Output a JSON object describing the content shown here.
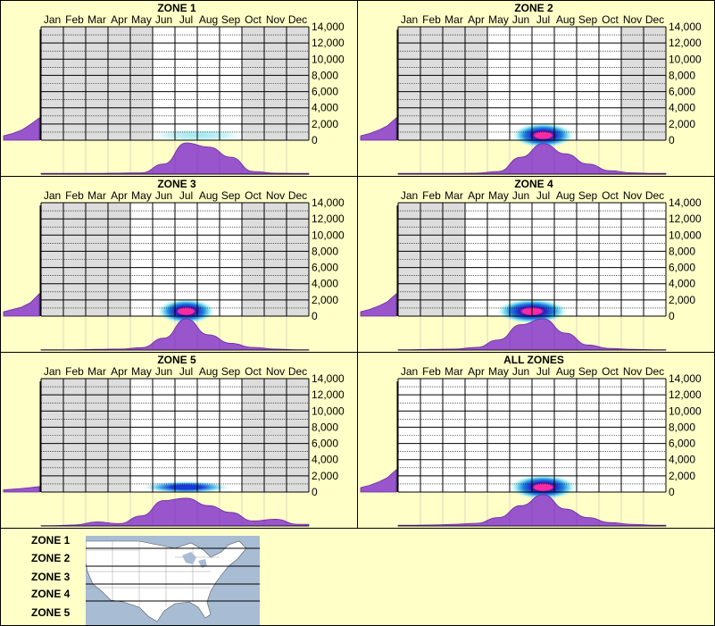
{
  "months": [
    "Jan",
    "Feb",
    "Mar",
    "Apr",
    "May",
    "Jun",
    "Jul",
    "Aug",
    "Sep",
    "Oct",
    "Nov",
    "Dec"
  ],
  "y_ticks": [
    "14,000",
    "12,000",
    "10,000",
    "8,000",
    "6,000",
    "4,000",
    "2,000",
    "0"
  ],
  "colors": {
    "background": "#ffffc8",
    "active_month": "#ffffff",
    "inactive_month": "#dddddd",
    "profile_fill": "#9955cc",
    "heat_core": "#ff2aa0",
    "heat_mid": "#1a2ad0",
    "heat_edge": "#bff0f5"
  },
  "chart_data": [
    {
      "type": "heatmap",
      "title": "ZONE 1",
      "ylim": [
        0,
        14000
      ],
      "active_months": [
        6,
        7,
        8,
        9
      ],
      "month_profile": [
        0.02,
        0.02,
        0.02,
        0.03,
        0.04,
        0.3,
        0.92,
        0.8,
        0.5,
        0.08,
        0.03,
        0.02
      ],
      "elevation_profile": [
        0.2,
        0.3,
        0.45,
        0.7,
        1.0
      ],
      "heat": {
        "month_center": 7.5,
        "month_spread": 2.2,
        "max_intensity": 0.3
      }
    },
    {
      "type": "heatmap",
      "title": "ZONE 2",
      "ylim": [
        0,
        14000
      ],
      "active_months": [
        5,
        6,
        7,
        8,
        9,
        10
      ],
      "month_profile": [
        0.02,
        0.02,
        0.02,
        0.03,
        0.08,
        0.5,
        0.9,
        0.6,
        0.3,
        0.1,
        0.04,
        0.02
      ],
      "elevation_profile": [
        0.2,
        0.3,
        0.45,
        0.65,
        1.0
      ],
      "heat": {
        "month_center": 7.0,
        "month_spread": 1.4,
        "max_intensity": 1.0
      }
    },
    {
      "type": "heatmap",
      "title": "ZONE 3",
      "ylim": [
        0,
        14000
      ],
      "active_months": [
        5,
        6,
        7,
        8,
        9
      ],
      "month_profile": [
        0.01,
        0.01,
        0.02,
        0.03,
        0.07,
        0.35,
        0.92,
        0.45,
        0.2,
        0.08,
        0.03,
        0.01
      ],
      "elevation_profile": [
        0.2,
        0.3,
        0.4,
        0.6,
        1.0
      ],
      "heat": {
        "month_center": 7.0,
        "month_spread": 1.3,
        "max_intensity": 1.0
      }
    },
    {
      "type": "heatmap",
      "title": "ZONE 4",
      "ylim": [
        0,
        14000
      ],
      "active_months": [
        4,
        5,
        6,
        7,
        8,
        9,
        10,
        11,
        12
      ],
      "month_profile": [
        0.01,
        0.02,
        0.03,
        0.08,
        0.3,
        0.75,
        0.92,
        0.5,
        0.15,
        0.05,
        0.02,
        0.01
      ],
      "elevation_profile": [
        0.2,
        0.3,
        0.45,
        0.65,
        1.0
      ],
      "heat": {
        "month_center": 6.5,
        "month_spread": 1.6,
        "max_intensity": 1.0
      }
    },
    {
      "type": "heatmap",
      "title": "ZONE 5",
      "ylim": [
        0,
        14000
      ],
      "active_months": [
        5,
        6,
        7,
        8,
        9
      ],
      "month_profile": [
        0.01,
        0.03,
        0.12,
        0.07,
        0.3,
        0.75,
        0.82,
        0.6,
        0.4,
        0.15,
        0.2,
        0.05
      ],
      "elevation_profile": [
        0.1,
        0.13,
        0.16,
        0.2,
        0.25
      ],
      "heat": {
        "month_center": 7.0,
        "month_spread": 2.0,
        "max_intensity": 0.55
      }
    },
    {
      "type": "heatmap",
      "title": "ALL ZONES",
      "ylim": [
        0,
        14000
      ],
      "active_months": [
        1,
        2,
        3,
        4,
        5,
        6,
        7,
        8,
        9,
        10,
        11,
        12
      ],
      "month_profile": [
        0.02,
        0.03,
        0.05,
        0.08,
        0.25,
        0.6,
        0.92,
        0.5,
        0.25,
        0.1,
        0.05,
        0.02
      ],
      "elevation_profile": [
        0.2,
        0.3,
        0.45,
        0.65,
        1.0
      ],
      "heat": {
        "month_center": 7.0,
        "month_spread": 1.5,
        "max_intensity": 1.0
      }
    }
  ],
  "legend": {
    "zones": [
      "ZONE 1",
      "ZONE 2",
      "ZONE 3",
      "ZONE 4",
      "ZONE 5"
    ],
    "map": "us-map-with-zone-lines"
  }
}
